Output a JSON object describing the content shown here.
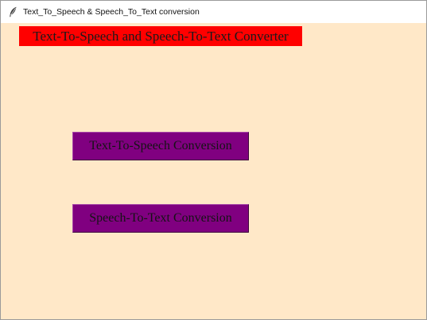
{
  "window": {
    "title": "Text_To_Speech & Speech_To_Text conversion",
    "icon": "feather-icon"
  },
  "main": {
    "heading": "Text-To-Speech and Speech-To-Text Converter",
    "buttons": {
      "tts_label": "Text-To-Speech Conversion",
      "stt_label": "Speech-To-Text Conversion"
    }
  },
  "colors": {
    "background": "#ffe8c8",
    "heading_bg": "#ff0000",
    "button_bg": "#800080"
  }
}
